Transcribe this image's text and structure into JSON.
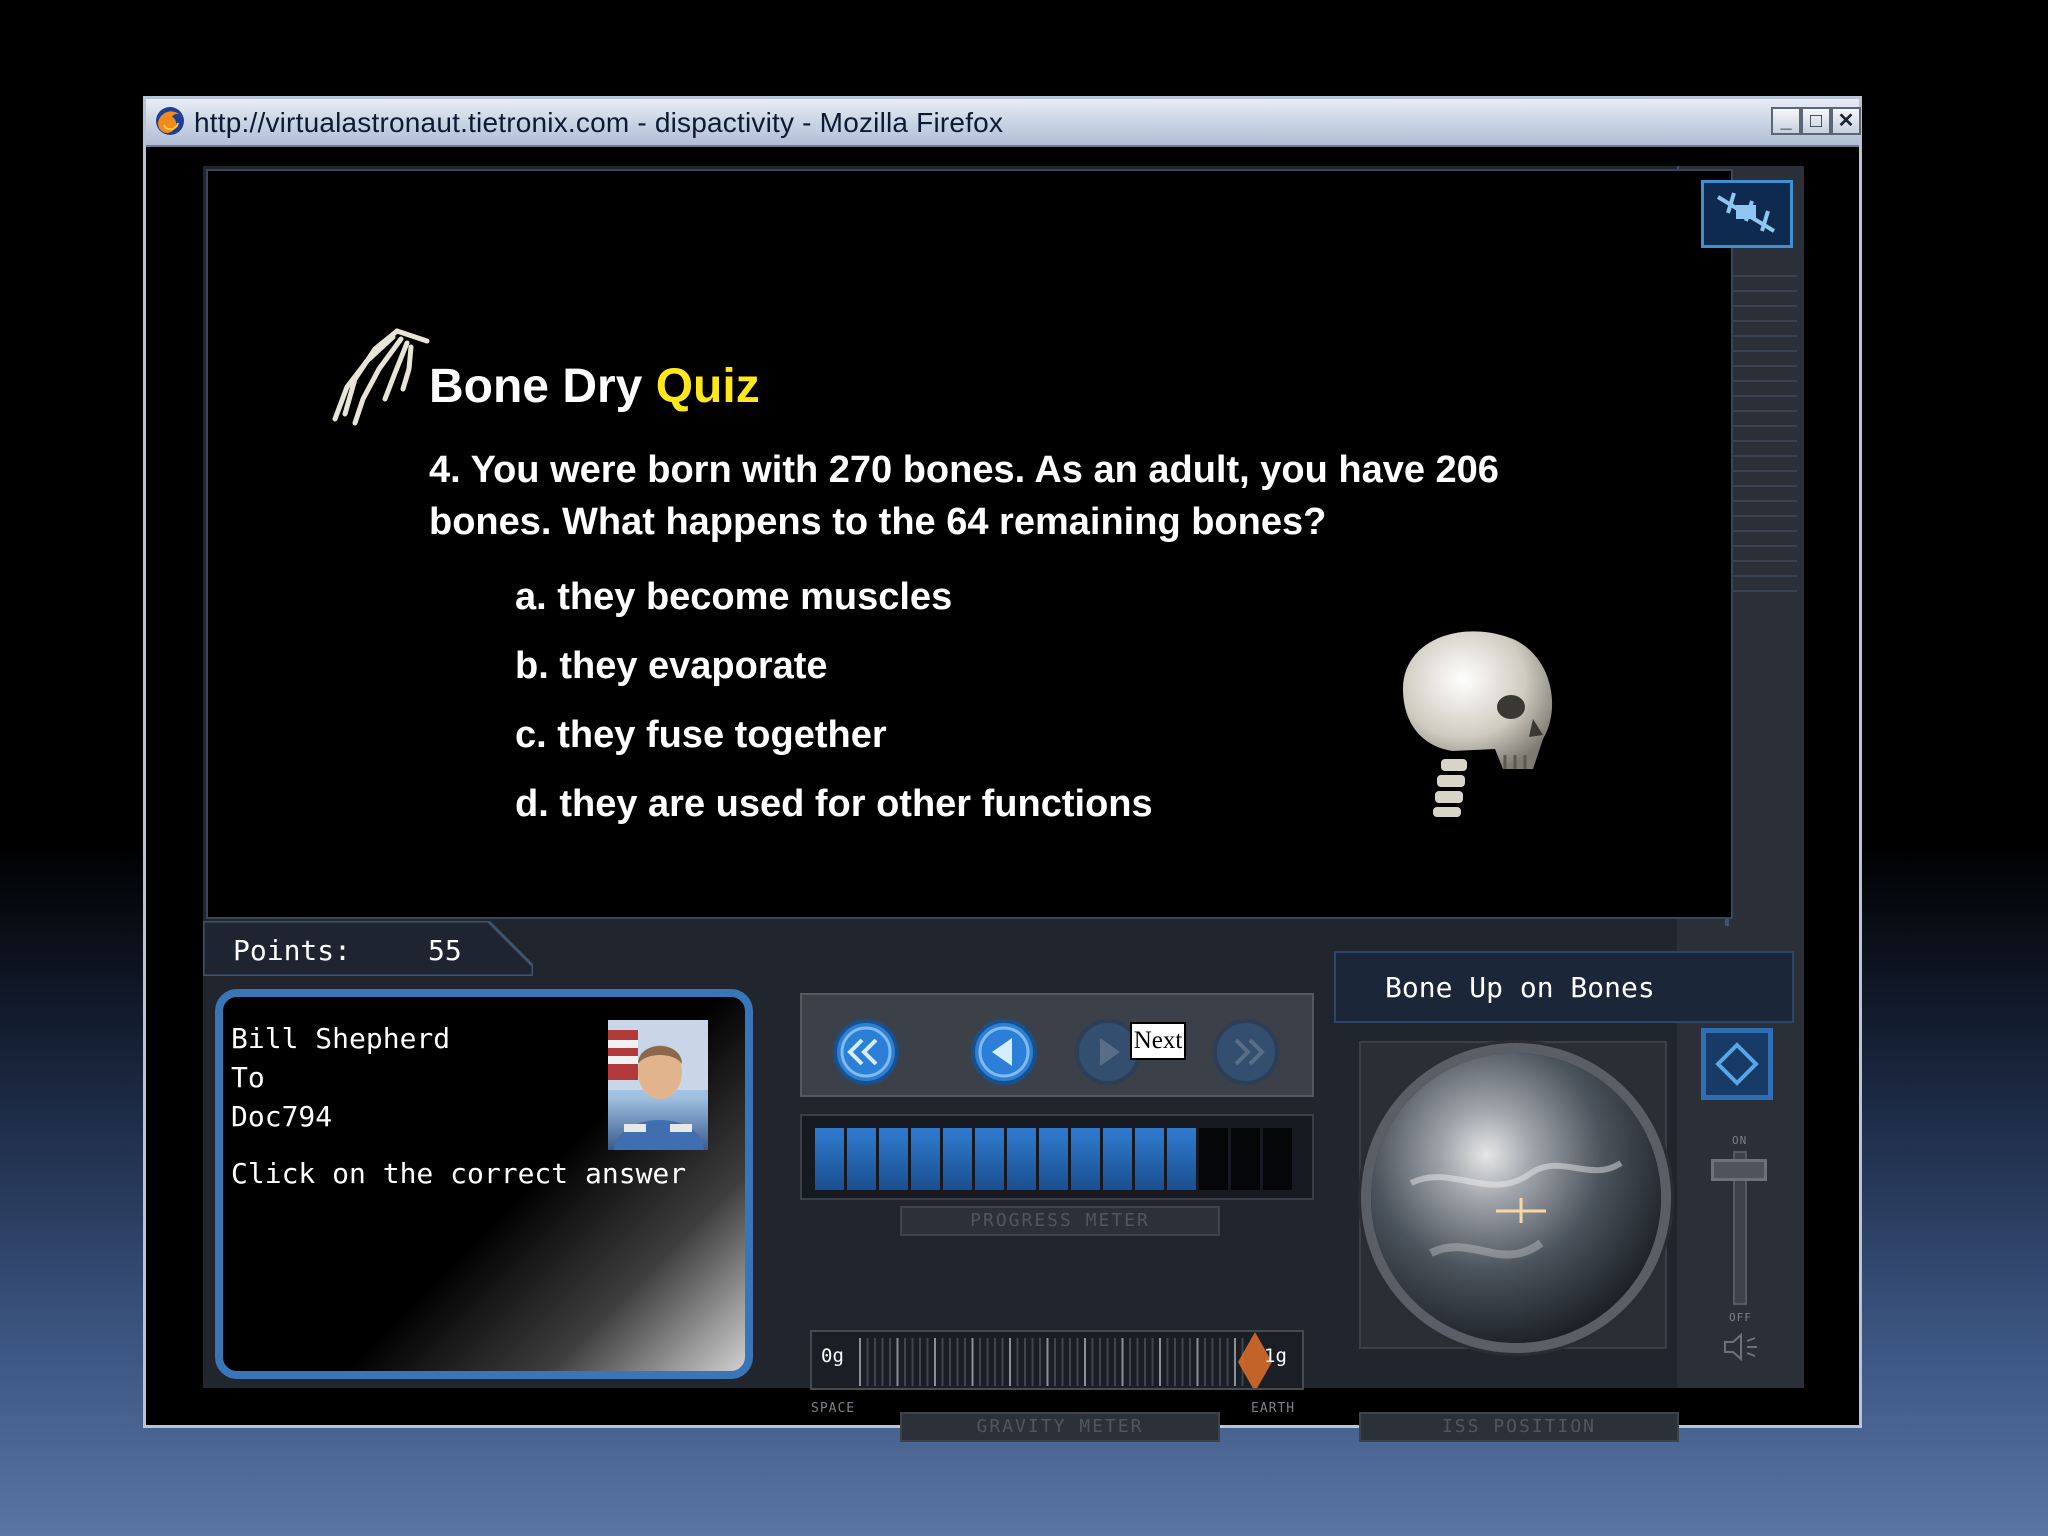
{
  "window": {
    "title": "http://virtualastronaut.tietronix.com - dispactivity - Mozilla Firefox",
    "buttons": {
      "minimize": "_",
      "maximize": "□",
      "close": "✕"
    }
  },
  "quiz": {
    "title_main": "Bone Dry",
    "title_accent": "Quiz",
    "question": "4. You were born with 270 bones. As an adult, you have 206 bones. What happens to the 64 remaining bones?",
    "answers": [
      "a. they become muscles",
      "b. they evaporate",
      "c. they fuse together",
      "d. they are used for other functions"
    ]
  },
  "points": {
    "label": "Points:",
    "value": "55"
  },
  "message": {
    "from": "Bill Shepherd",
    "to_label": "To",
    "recipient": "Doc794",
    "text": "Click on the correct answer"
  },
  "navigation": {
    "next_tooltip": "Next"
  },
  "progress_meter": {
    "label": "PROGRESS METER",
    "filled_segments": 12,
    "total_segments": 15
  },
  "gravity_meter": {
    "label": "GRAVITY METER",
    "min_label": "0g",
    "max_label": "1g",
    "left_caption": "SPACE",
    "right_caption": "EARTH"
  },
  "topic": {
    "title": "Bone Up on Bones"
  },
  "iss_position": {
    "label": "ISS POSITION"
  },
  "volume": {
    "on_label": "ON",
    "off_label": "OFF"
  },
  "colors": {
    "accent": "#ffe71a",
    "panel_blue": "#3a75b8",
    "progress_blue": "#1e5ea5"
  }
}
